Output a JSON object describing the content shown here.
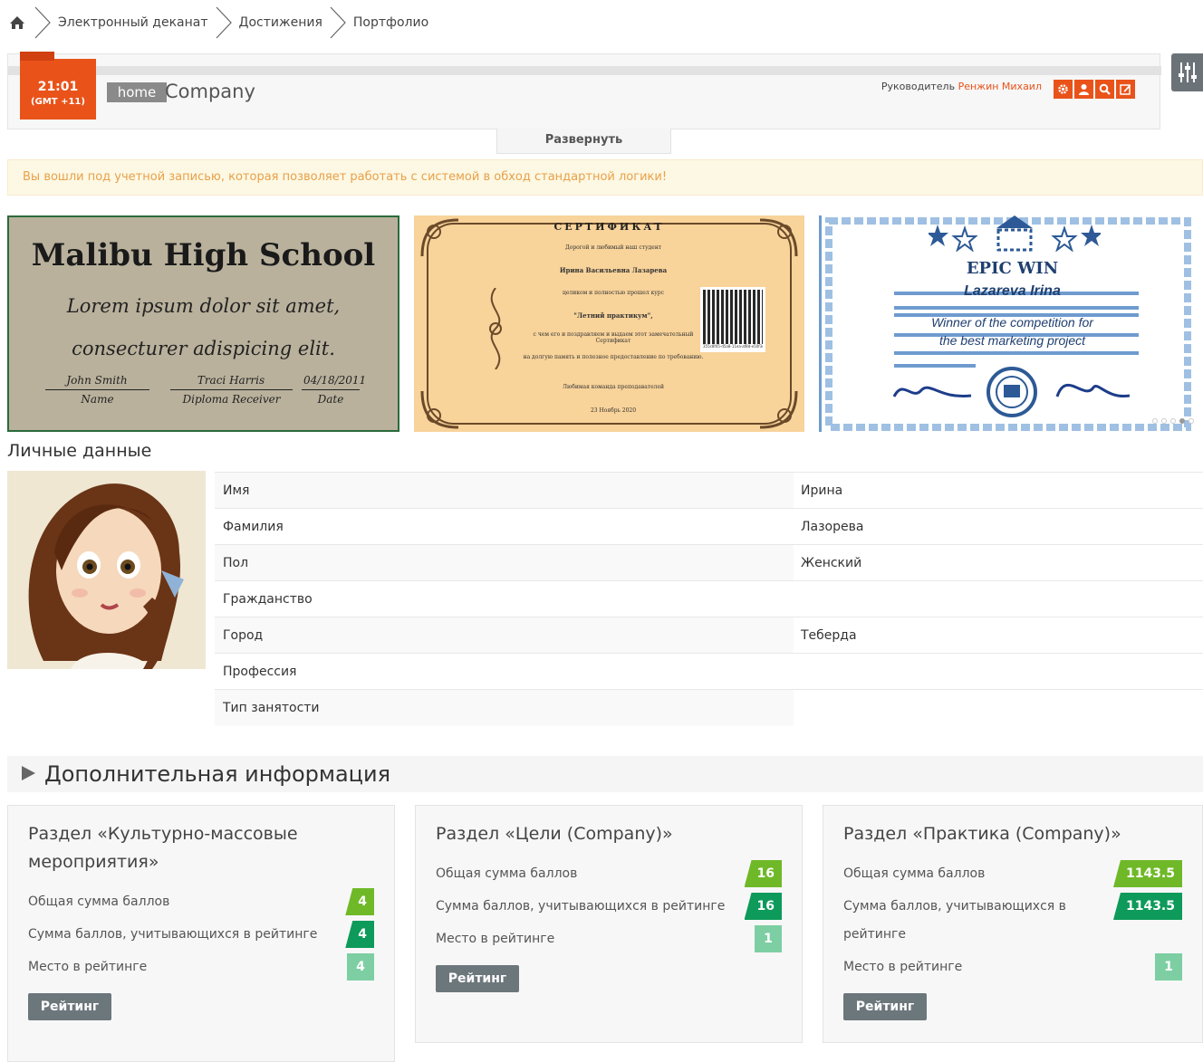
{
  "breadcrumb": {
    "items": [
      "Электронный деканат",
      "Достижения",
      "Портфолио"
    ]
  },
  "header": {
    "clock_time": "21:01",
    "clock_tz": "(GMT +11)",
    "home_label": "home",
    "title": "Company",
    "manager_label": "Руководитель",
    "manager_name": "Ренжин Михаил",
    "buttons": [
      "gear-icon",
      "user-icon",
      "search-icon",
      "edit-icon"
    ],
    "expand_label": "Развернуть"
  },
  "alert": "Вы вошли под учетной записью, которая позволяет работать с системой в обход стандартной логики!",
  "carousel": {
    "slide1": {
      "title": "Malibu High School",
      "line1": "Lorem ipsum dolor sit amet,",
      "line2": "consecturer adispicing elit.",
      "sig1": "John Smith",
      "sig1_role": "Name",
      "sig2": "Traci Harris",
      "sig2_role": "Diploma Receiver",
      "sig3": "04/18/2011",
      "sig3_role": "Date"
    },
    "slide2": {
      "title": "СЕРТИФИКАТ",
      "l1": "Дорогой и любимый наш студент",
      "l2": "Ирина Васильевна Лазарева",
      "l3": "целиком и полностью прошел курс",
      "l4": "\"Летний практикум\",",
      "l5": "с чем его и поздравляем и выдаем этот замечательный Сертификат",
      "l6": "на долгую память и полезное предоставление по требованию.",
      "l7": "Любимая команда преподавателей",
      "l8": "23 Ноябрь 2020",
      "qr_caption": "355c8f45-d5a8-11ea-af8d-e50f3c9d4f7"
    },
    "slide3": {
      "title": "EPIC WIN",
      "name": "Lazareva Irina",
      "line1": "Winner of the competition for",
      "line2": "the best marketing project"
    },
    "dots": 5,
    "active_dot": 4
  },
  "personal": {
    "title": "Личные данные",
    "rows": [
      {
        "key": "Имя",
        "value": "Ирина"
      },
      {
        "key": "Фамилия",
        "value": "Лазорева"
      },
      {
        "key": "Пол",
        "value": "Женский"
      },
      {
        "key": "Гражданство",
        "value": ""
      },
      {
        "key": "Город",
        "value": "Теберда"
      },
      {
        "key": "Профессия",
        "value": ""
      },
      {
        "key": "Тип занятости",
        "value": ""
      }
    ]
  },
  "extra": {
    "title": "Дополнительная информация"
  },
  "cards": [
    {
      "title": "Раздел «Культурно-массовые мероприятия»",
      "total_label": "Общая сумма баллов",
      "total": "4",
      "rated_label": "Сумма баллов, учитывающихся в рейтинге",
      "rated": "4",
      "place_label": "Место в рейтинге",
      "place": "4",
      "button": "Рейтинг"
    },
    {
      "title": "Раздел «Цели (Company)»",
      "total_label": "Общая сумма баллов",
      "total": "16",
      "rated_label": "Сумма баллов, учитывающихся в рейтинге",
      "rated": "16",
      "place_label": "Место в рейтинге",
      "place": "1",
      "button": "Рейтинг"
    },
    {
      "title": "Раздел «Практика (Company)»",
      "total_label": "Общая сумма баллов",
      "total": "1143.5",
      "rated_label": "Сумма баллов, учитывающихся в рейтинге",
      "rated": "1143.5",
      "place_label": "Место в рейтинге",
      "place": "1",
      "button": "Рейтинг"
    }
  ],
  "colors": {
    "accent": "#e9531a",
    "lime": "#6fb928",
    "green": "#0e9a5a",
    "mint": "#7dcfa3",
    "button": "#6c777c"
  }
}
